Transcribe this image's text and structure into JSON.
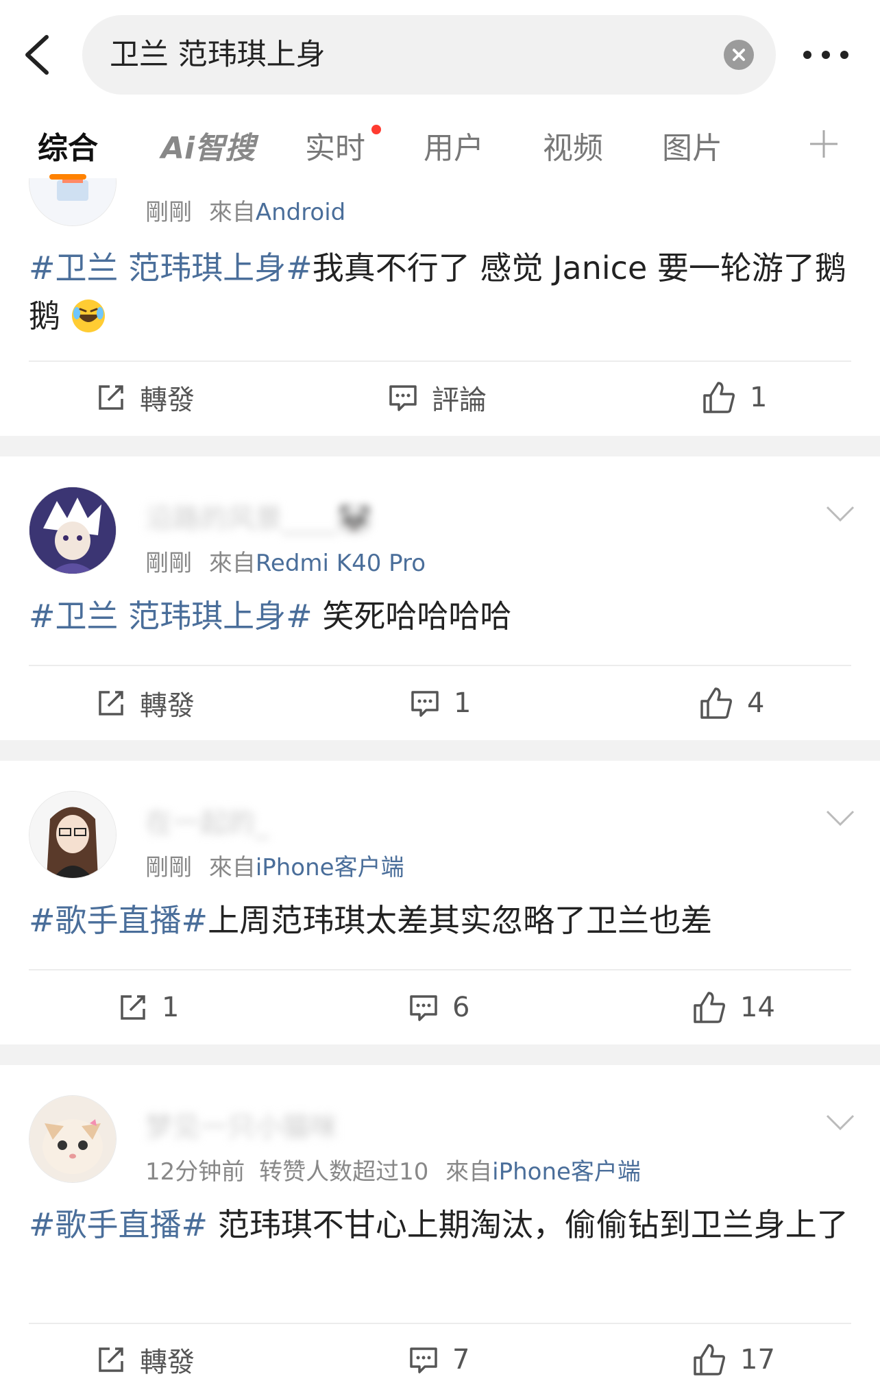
{
  "search": {
    "query": "卫兰 范玮琪上身"
  },
  "tabs": [
    {
      "label": "综合"
    },
    {
      "label": "Ai智搜"
    },
    {
      "label": "实时"
    },
    {
      "label": "用户"
    },
    {
      "label": "视频"
    },
    {
      "label": "图片"
    }
  ],
  "posts": [
    {
      "time": "剛剛",
      "from_prefix": "來自",
      "source": "Android",
      "hashtag": "#卫兰 范玮琪上身#",
      "text": "我真不行了 感觉 Janice 要一轮游了鹅鹅",
      "repost": "轉發",
      "comment": "評論",
      "like": "1"
    },
    {
      "username": "沿路的风景____🐼",
      "time": "剛剛",
      "from_prefix": "來自",
      "source": "Redmi K40 Pro",
      "hashtag": "#卫兰 范玮琪上身#",
      "text": " 笑死哈哈哈哈",
      "repost": "轉發",
      "comment": "1",
      "like": "4"
    },
    {
      "username": "在一起的_",
      "time": "剛剛",
      "from_prefix": "來自",
      "source": "iPhone客户端",
      "hashtag": "#歌手直播#",
      "text": "上周范玮琪太差其实忽略了卫兰也差",
      "repost": "1",
      "comment": "6",
      "like": "14"
    },
    {
      "username": "梦见一只小猫咪",
      "time": "12分钟前",
      "extra": "转赞人数超过10",
      "from_prefix": "來自",
      "source": "iPhone客户端",
      "hashtag": "#歌手直播#",
      "text": " 范玮琪不甘心上期淘汰，偷偷钻到卫兰身上了",
      "repost": "轉發",
      "comment": "7",
      "like": "17"
    }
  ],
  "colors": {
    "link": "#4a6e9a",
    "accent": "#ff8200",
    "dot": "#ff3b30"
  },
  "icons": [
    "back-arrow-icon",
    "clear-icon",
    "more-icon",
    "plus-icon",
    "repost-icon",
    "comment-icon",
    "like-icon",
    "chevron-down-icon",
    "laughing-cry-emoji"
  ]
}
